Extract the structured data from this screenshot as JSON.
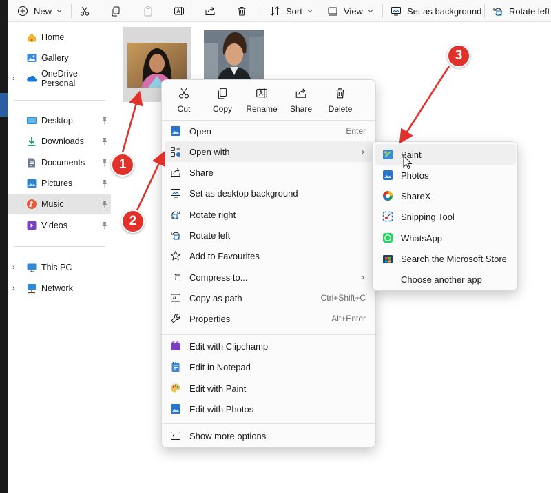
{
  "colors": {
    "accent": "#0067c0",
    "annotation": "#e0312b",
    "menu_hover": "#efefef"
  },
  "toolbar": {
    "new_label": "New",
    "sort_label": "Sort",
    "view_label": "View",
    "set_background_label": "Set as background",
    "rotate_left_label": "Rotate left",
    "icons": [
      "plus-circle-icon",
      "cut-icon",
      "copy-icon",
      "paste-icon",
      "rename-icon",
      "share-icon",
      "delete-icon",
      "sort-icon",
      "view-icon",
      "background-icon",
      "rotate-left-icon"
    ]
  },
  "nav": {
    "items": [
      {
        "label": "Home",
        "icon": "home-icon"
      },
      {
        "label": "Gallery",
        "icon": "gallery-icon"
      },
      {
        "label": "OneDrive - Personal",
        "icon": "onedrive-icon"
      },
      {
        "label": "Desktop",
        "icon": "desktop-icon"
      },
      {
        "label": "Downloads",
        "icon": "downloads-icon"
      },
      {
        "label": "Documents",
        "icon": "documents-icon"
      },
      {
        "label": "Pictures",
        "icon": "pictures-icon"
      },
      {
        "label": "Music",
        "icon": "music-icon",
        "selected": true
      },
      {
        "label": "Videos",
        "icon": "videos-icon"
      },
      {
        "label": "This PC",
        "icon": "this-pc-icon"
      },
      {
        "label": "Network",
        "icon": "network-icon"
      }
    ]
  },
  "context_menu": {
    "quick_actions": [
      {
        "label": "Cut",
        "icon": "cut-icon"
      },
      {
        "label": "Copy",
        "icon": "copy-icon"
      },
      {
        "label": "Rename",
        "icon": "rename-icon"
      },
      {
        "label": "Share",
        "icon": "share-icon"
      },
      {
        "label": "Delete",
        "icon": "delete-icon"
      }
    ],
    "items": [
      {
        "label": "Open",
        "shortcut": "Enter",
        "icon": "open-icon"
      },
      {
        "label": "Open with",
        "icon": "open-with-icon",
        "submenu": true
      },
      {
        "label": "Share",
        "icon": "share-icon"
      },
      {
        "label": "Set as desktop background",
        "icon": "desktop-background-icon"
      },
      {
        "label": "Rotate right",
        "icon": "rotate-right-icon"
      },
      {
        "label": "Rotate left",
        "icon": "rotate-left-icon"
      },
      {
        "label": "Add to Favourites",
        "icon": "star-icon"
      },
      {
        "label": "Compress to...",
        "icon": "compress-icon",
        "submenu": true
      },
      {
        "label": "Copy as path",
        "shortcut": "Ctrl+Shift+C",
        "icon": "copy-path-icon"
      },
      {
        "label": "Properties",
        "shortcut": "Alt+Enter",
        "icon": "properties-icon"
      },
      {
        "label": "Edit with Clipchamp",
        "icon": "clipchamp-icon"
      },
      {
        "label": "Edit in Notepad",
        "icon": "notepad-icon"
      },
      {
        "label": "Edit with Paint",
        "icon": "paint-icon"
      },
      {
        "label": "Edit with Photos",
        "icon": "photos-icon"
      },
      {
        "label": "Show more options",
        "icon": "more-options-icon"
      }
    ]
  },
  "submenu": {
    "items": [
      {
        "label": "Paint",
        "icon": "paint-icon"
      },
      {
        "label": "Photos",
        "icon": "photos-icon"
      },
      {
        "label": "ShareX",
        "icon": "sharex-icon"
      },
      {
        "label": "Snipping Tool",
        "icon": "snipping-tool-icon"
      },
      {
        "label": "WhatsApp",
        "icon": "whatsapp-icon"
      },
      {
        "label": "Search the Microsoft Store",
        "icon": "store-icon"
      },
      {
        "label": "Choose another app",
        "icon": ""
      }
    ]
  },
  "annotations": {
    "steps": [
      "1",
      "2",
      "3"
    ]
  }
}
